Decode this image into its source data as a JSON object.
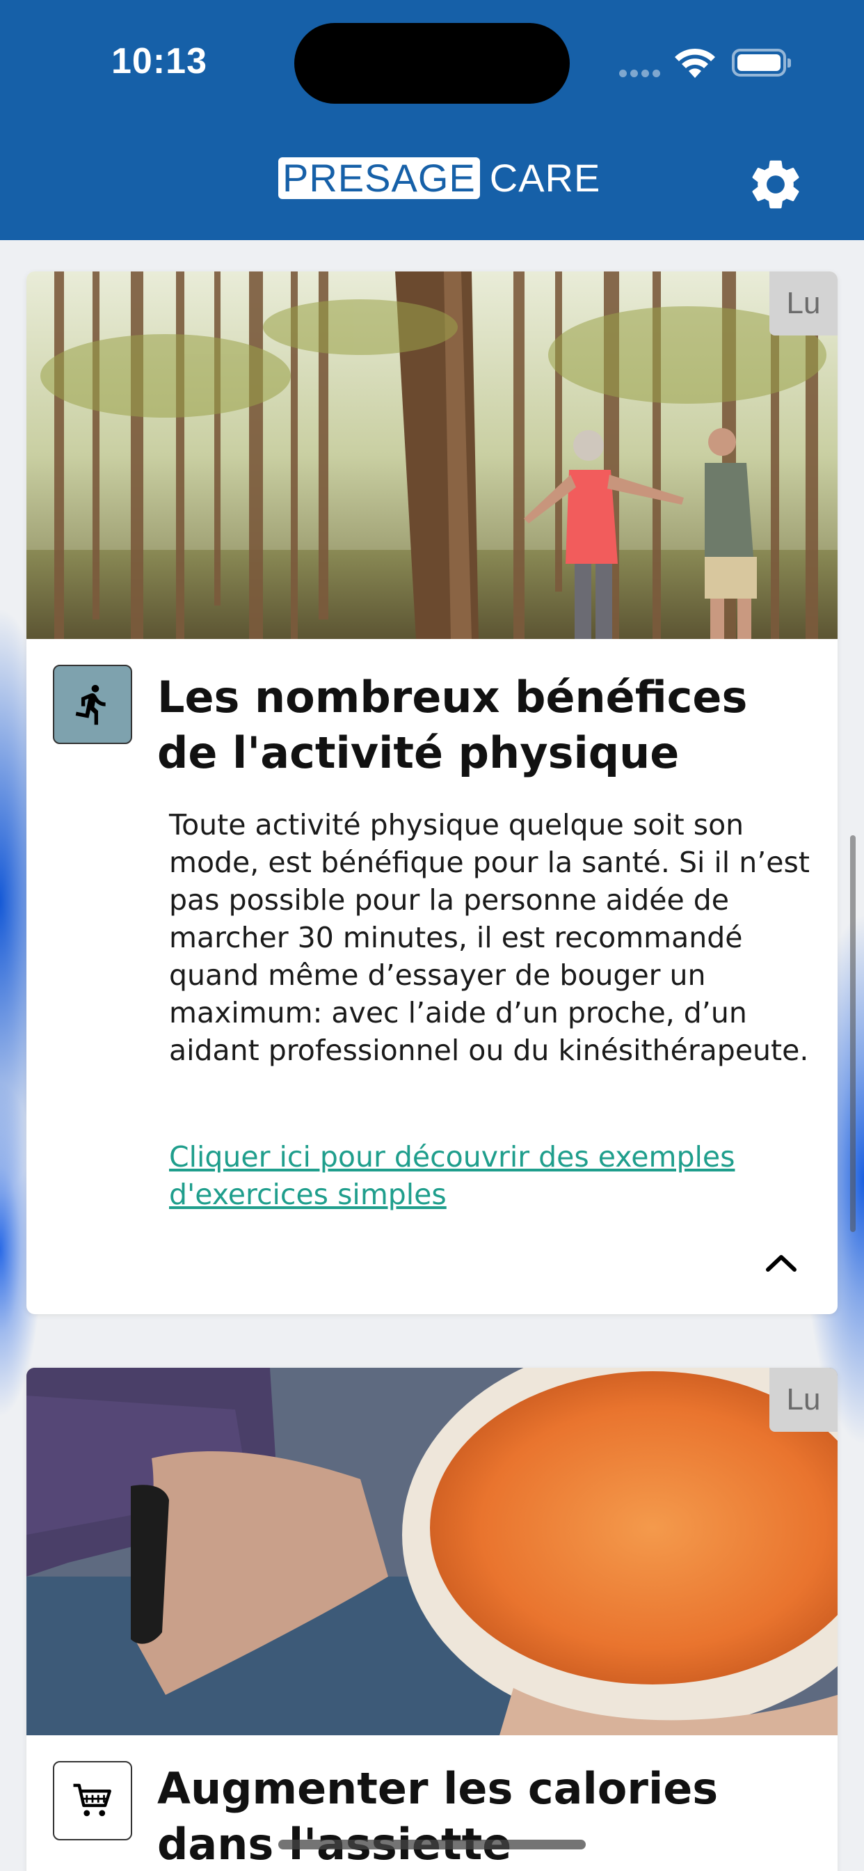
{
  "status_bar": {
    "time": "10:13"
  },
  "header": {
    "logo_boxed": "PRESAGE",
    "logo_plain": "CARE",
    "settings_icon": "gear-icon"
  },
  "colors": {
    "header_bg": "#1660a8",
    "link": "#1f9e8c",
    "activity_icon_bg": "#7ea2ae"
  },
  "cards": [
    {
      "read_label": "Lu",
      "icon": "running-person-icon",
      "image": "seniors walking in forest",
      "title": "Les nombreux bénéfices de l'activité physique",
      "body": "Toute activité physique quelque soit son mode, est bénéfique pour la santé. Si il n’est pas possible pour la personne aidée de marcher 30 minutes,  il est recommandé quand même d’essayer de bouger un maximum: avec l’aide d’un proche, d’un aidant professionnel ou du kinésithérapeute.",
      "link": "Cliquer ici pour découvrir des exemples d'exercices simples",
      "expanded": true
    },
    {
      "read_label": "Lu",
      "icon": "shopping-cart-icon",
      "image": "hands holding bowl of soup",
      "title": "Augmenter les calories dans l'assiette"
    }
  ]
}
